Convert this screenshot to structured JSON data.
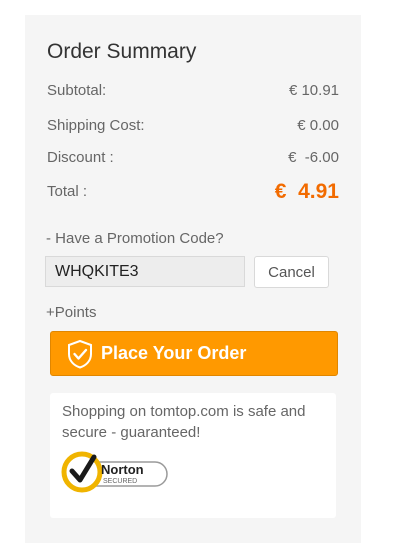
{
  "summary": {
    "title": "Order Summary",
    "subtotal_label": "Subtotal:",
    "subtotal_value": "€ 10.91",
    "shipping_label": "Shipping Cost:",
    "shipping_value": "€ 0.00",
    "discount_label": "Discount :",
    "discount_value": "€  -6.00",
    "total_label": "Total :",
    "total_value": "€  4.91"
  },
  "promo": {
    "link_text": "- Have a Promotion Code?",
    "code_value": "WHQKITE3",
    "cancel_label": "Cancel"
  },
  "points_label": "+Points",
  "place_order_label": "Place Your Order",
  "secure": {
    "text": "Shopping on tomtop.com is safe and secure - guaranteed!",
    "badge_name": "Norton",
    "badge_sub": "SECURED"
  },
  "icons": {
    "order_button": "shield-check-icon",
    "badge": "norton-secured-logo"
  },
  "colors": {
    "accent": "#ff9900",
    "total": "#f26b00",
    "panel": "#f5f5f5"
  }
}
